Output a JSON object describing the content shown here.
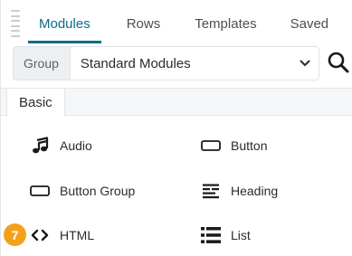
{
  "tabs": [
    {
      "label": "Modules",
      "active": true
    },
    {
      "label": "Rows",
      "active": false
    },
    {
      "label": "Templates",
      "active": false
    },
    {
      "label": "Saved",
      "active": false
    }
  ],
  "filter": {
    "group_label": "Group",
    "selected_value": "Standard Modules"
  },
  "category": {
    "label": "Basic"
  },
  "modules": [
    {
      "label": "Audio",
      "icon": "music-note-icon"
    },
    {
      "label": "Button",
      "icon": "button-icon"
    },
    {
      "label": "Button Group",
      "icon": "button-group-icon"
    },
    {
      "label": "Heading",
      "icon": "heading-icon"
    },
    {
      "label": "HTML",
      "icon": "code-icon"
    },
    {
      "label": "List",
      "icon": "list-icon"
    }
  ],
  "badge": {
    "value": "7",
    "color": "#f4a11a"
  },
  "colors": {
    "accent": "#0e6b86"
  }
}
